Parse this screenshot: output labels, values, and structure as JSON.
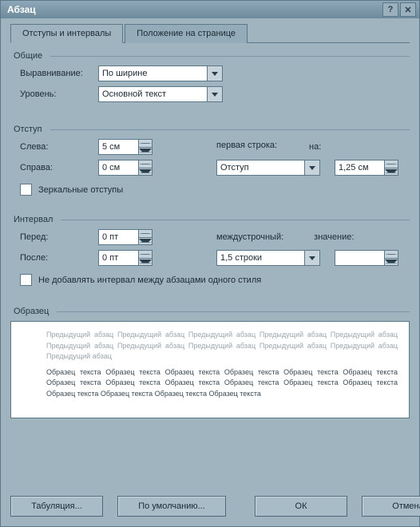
{
  "window": {
    "title": "Абзац"
  },
  "tabs": {
    "t1": "Отступы и интервалы",
    "t2": "Положение на странице"
  },
  "groups": {
    "general": "Общие",
    "indent": "Отступ",
    "spacing": "Интервал",
    "preview": "Образец"
  },
  "general": {
    "align_label": "Выравнивание:",
    "align_value": "По ширине",
    "level_label": "Уровень:",
    "level_value": "Основной текст"
  },
  "indent": {
    "left_label": "Слева:",
    "left_value": "5 см",
    "right_label": "Справа:",
    "right_value": "0 см",
    "first_label": "первая строка:",
    "first_value": "Отступ",
    "by_label": "на:",
    "by_value": "1,25 см",
    "mirror_label": "Зеркальные отступы"
  },
  "spacing": {
    "before_label": "Перед:",
    "before_value": "0 пт",
    "after_label": "После:",
    "after_value": "0 пт",
    "line_label": "междустрочный:",
    "line_value": "1,5 строки",
    "at_label": "значение:",
    "at_value": "",
    "nospace_label": "Не добавлять интервал между абзацами одного стиля"
  },
  "preview": {
    "prev": "Предыдущий абзац Предыдущий абзац Предыдущий абзац Предыдущий абзац Предыдущий абзац Предыдущий абзац Предыдущий абзац Предыдущий абзац Предыдущий абзац Предыдущий абзац Предыдущий абзац",
    "sample": "Образец текста Образец текста Образец текста Образец текста Образец текста Образец текста Образец текста Образец текста Образец текста Образец текста Образец текста Образец текста Образец текста Образец текста Образец текста Образец текста"
  },
  "buttons": {
    "tabs": "Табуляция...",
    "default": "По умолчанию...",
    "ok": "ОК",
    "cancel": "Отмена"
  }
}
